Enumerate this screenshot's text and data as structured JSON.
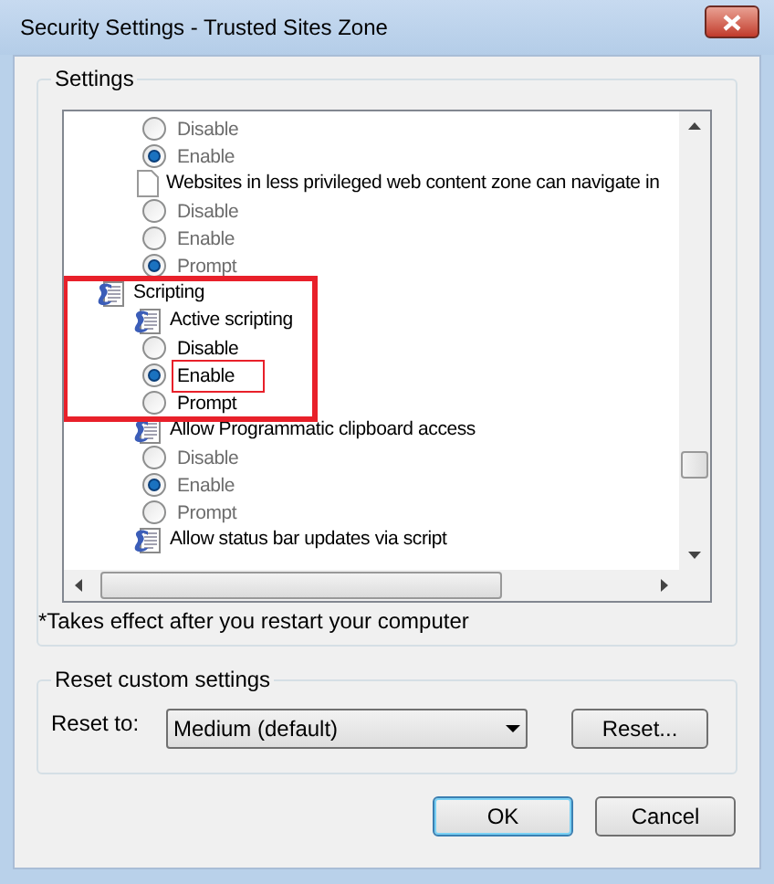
{
  "window": {
    "title": "Security Settings - Trusted Sites Zone"
  },
  "settings": {
    "label": "Settings",
    "tree": [
      {
        "kind": "group",
        "children": [
          {
            "kind": "group",
            "children": [
              {
                "kind": "option",
                "label": "Disable",
                "selected": false,
                "dimmed": true
              },
              {
                "kind": "option",
                "label": "Enable",
                "selected": true,
                "dimmed": true
              }
            ]
          },
          {
            "kind": "page-setting",
            "label": "Websites in less privileged web content zone can navigate in",
            "children": [
              {
                "kind": "option",
                "label": "Disable",
                "selected": false,
                "dimmed": true
              },
              {
                "kind": "option",
                "label": "Enable",
                "selected": false,
                "dimmed": true
              },
              {
                "kind": "option",
                "label": "Prompt",
                "selected": true,
                "dimmed": true
              }
            ]
          }
        ]
      },
      {
        "kind": "category",
        "label": "Scripting",
        "highlighted": true,
        "children": [
          {
            "kind": "script-setting",
            "label": "Active scripting",
            "children": [
              {
                "kind": "option",
                "label": "Disable",
                "selected": false,
                "dimmed": false
              },
              {
                "kind": "option",
                "label": "Enable",
                "selected": true,
                "dimmed": false,
                "highlighted": true
              },
              {
                "kind": "option",
                "label": "Prompt",
                "selected": false,
                "dimmed": false
              }
            ]
          },
          {
            "kind": "script-setting",
            "label": "Allow Programmatic clipboard access",
            "children": [
              {
                "kind": "option",
                "label": "Disable",
                "selected": false,
                "dimmed": true
              },
              {
                "kind": "option",
                "label": "Enable",
                "selected": true,
                "dimmed": true
              },
              {
                "kind": "option",
                "label": "Prompt",
                "selected": false,
                "dimmed": true
              }
            ]
          },
          {
            "kind": "script-setting",
            "label": "Allow status bar updates via script"
          }
        ]
      }
    ],
    "note": "*Takes effect after you restart your computer"
  },
  "reset": {
    "label": "Reset custom settings",
    "field_label": "Reset to:",
    "value": "Medium (default)",
    "button": "Reset..."
  },
  "buttons": [
    {
      "label": "OK",
      "default": true
    },
    {
      "label": "Cancel",
      "default": false
    }
  ]
}
